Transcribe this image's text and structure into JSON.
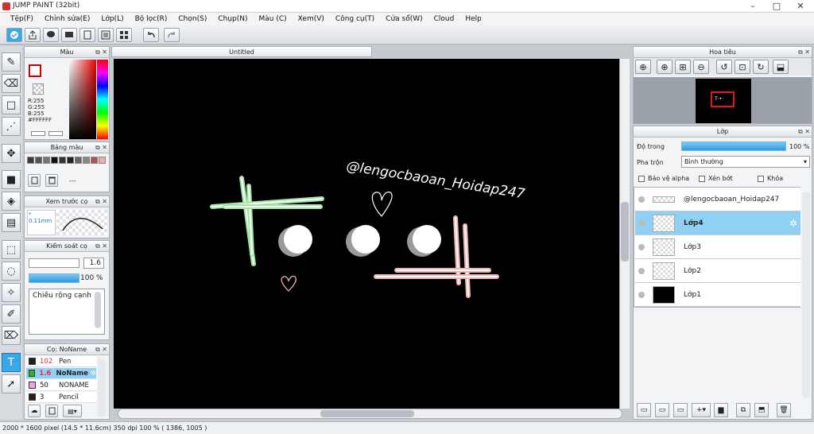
{
  "window": {
    "title": "JUMP PAINT (32bit)"
  },
  "menu": [
    "Tệp(F)",
    "Chỉnh sửa(E)",
    "Lớp(L)",
    "Bộ lọc(R)",
    "Chọn(S)",
    "Chụp(N)",
    "Màu (C)",
    "Xem(V)",
    "Công cụ(T)",
    "Cửa sổ(W)",
    "Cloud",
    "Help"
  ],
  "color_panel": {
    "title": "Màu",
    "r": "R:255",
    "g": "G:255",
    "b": "B:255",
    "hex": "#FFFFFF"
  },
  "palette_panel": {
    "title": "Bảng màu",
    "dash": "---",
    "colors": [
      "#3a3a3a",
      "#555",
      "#777",
      "#111",
      "#333",
      "#222",
      "#666",
      "#888",
      "#a55",
      "#f4a8a8"
    ]
  },
  "brush_preview": {
    "title": "Xem trước cọ",
    "size": "0.11mm"
  },
  "brush_control": {
    "title": "Kiểm soát cọ",
    "size_value": "1.6",
    "opacity_value": "100 %",
    "width_label": "Chiều rộng cạnh"
  },
  "brush_list": {
    "title": "Cọ: NoName",
    "items": [
      {
        "size": "102",
        "name": "Pen",
        "color": "#222",
        "size_color": "#e0324a"
      },
      {
        "size": "1.6",
        "name": "NoName",
        "color": "#2db52d",
        "size_color": "#e0324a"
      },
      {
        "size": "50",
        "name": "NONAME",
        "color": "#f0a6e0",
        "size_color": "#111"
      },
      {
        "size": "3",
        "name": "Pencil",
        "color": "#222",
        "size_color": "#111"
      }
    ]
  },
  "document": {
    "tab": "Untitled"
  },
  "canvas": {
    "watermark": "@lengocbaoan_Hoidap247"
  },
  "navigator": {
    "title": "Hoa tiêu"
  },
  "layers": {
    "title": "Lớp",
    "opacity_label": "Độ trong",
    "opacity_value": "100 %",
    "opacity_fraction": 1.0,
    "blend_label": "Pha trộn",
    "blend_value": "Bình thường",
    "protect_alpha": "Bảo vệ alpha",
    "clipping": "Xén bớt",
    "lock": "Khóa",
    "items": [
      {
        "name": "@lengocbaoan_Hoidap247",
        "selected": false
      },
      {
        "name": "Lớp4",
        "selected": true
      },
      {
        "name": "Lớp3",
        "selected": false
      },
      {
        "name": "Lớp2",
        "selected": false
      },
      {
        "name": "Lớp1",
        "selected": false
      }
    ]
  },
  "status": {
    "text": "2000 * 1600 pixel  (14.5 * 11.6cm)  350 dpi  100 %  ( 1386, 1005 )"
  },
  "colors": {
    "accent": "#3aa7e6",
    "selection": "#8fd0f3",
    "canvas_bg": "#000000"
  }
}
